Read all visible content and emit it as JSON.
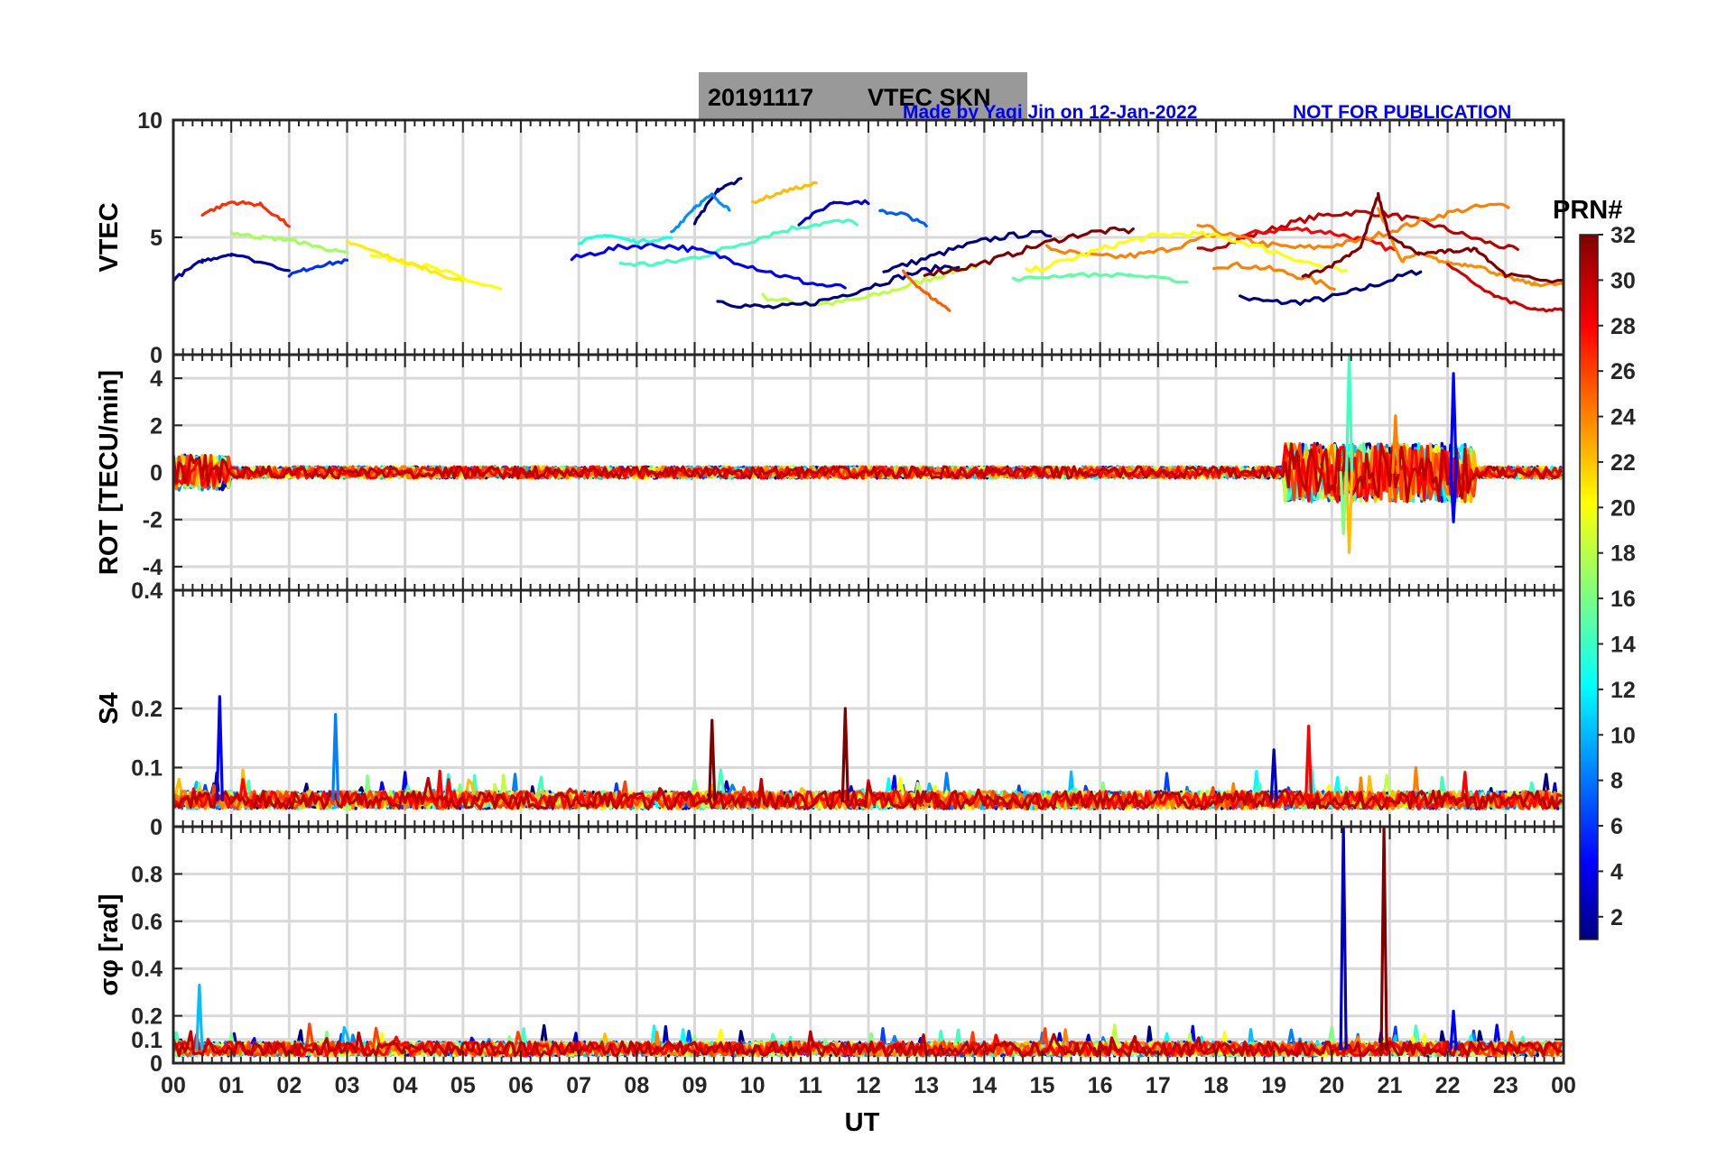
{
  "title": {
    "date": "20191117",
    "label": "VTEC  SKN"
  },
  "credit": {
    "author": "Made by Yaqi Jin on 12-Jan-2022",
    "notice": "NOT FOR PUBLICATION"
  },
  "colorbar": {
    "label": "PRN#",
    "ticks": [
      "2",
      "4",
      "6",
      "8",
      "10",
      "12",
      "14",
      "16",
      "18",
      "20",
      "22",
      "24",
      "26",
      "28",
      "30",
      "32"
    ],
    "range": [
      1,
      32
    ],
    "colormap": "jet"
  },
  "x_axis": {
    "label": "UT",
    "ticks": [
      "00",
      "01",
      "02",
      "03",
      "04",
      "05",
      "06",
      "07",
      "08",
      "09",
      "10",
      "11",
      "12",
      "13",
      "14",
      "15",
      "16",
      "17",
      "18",
      "19",
      "20",
      "21",
      "22",
      "23",
      "00"
    ],
    "range_hours": [
      0,
      24
    ]
  },
  "chart_data": [
    {
      "type": "line",
      "ylabel": "VTEC",
      "ylim": [
        0,
        10
      ],
      "yticks": [
        "0",
        "5",
        "10"
      ],
      "grid": true,
      "series": [
        {
          "prn": 2,
          "color": "#00007f",
          "x": [
            9.0,
            9.4,
            9.8
          ],
          "y": [
            5.6,
            7.0,
            7.5
          ]
        },
        {
          "prn": 3,
          "color": "#0000a8",
          "x": [
            0,
            0.5,
            1,
            2
          ],
          "y": [
            3.2,
            4.0,
            4.3,
            3.6
          ]
        },
        {
          "prn": 5,
          "color": "#0000d4",
          "x": [
            10.8,
            11.4,
            12.0
          ],
          "y": [
            5.6,
            6.5,
            6.5
          ]
        },
        {
          "prn": 6,
          "color": "#0030ff",
          "x": [
            2.0,
            2.5,
            3.0
          ],
          "y": [
            3.4,
            3.8,
            4.0
          ]
        },
        {
          "prn": 8,
          "color": "#005cff",
          "x": [
            12.2,
            12.6,
            13.0
          ],
          "y": [
            6.1,
            6.0,
            5.5
          ]
        },
        {
          "prn": 10,
          "color": "#0090ff",
          "x": [
            8.6,
            9.0,
            9.3,
            9.6
          ],
          "y": [
            5.2,
            6.3,
            6.8,
            6.2
          ]
        },
        {
          "prn": 13,
          "color": "#20ffdd",
          "x": [
            7.0,
            7.5,
            8.0,
            8.6
          ],
          "y": [
            4.8,
            5.1,
            4.8,
            5.0
          ]
        },
        {
          "prn": 15,
          "color": "#5cffa1",
          "x": [
            14.5,
            15.5,
            16.5,
            17.5
          ],
          "y": [
            3.2,
            3.4,
            3.4,
            3.1
          ]
        },
        {
          "prn": 18,
          "color": "#a1ff5c",
          "x": [
            1,
            1.5,
            2,
            2.5,
            3.0
          ],
          "y": [
            5.2,
            5.0,
            4.9,
            4.6,
            4.3
          ]
        },
        {
          "prn": 20,
          "color": "#ffec00",
          "x": [
            3.0,
            3.7,
            4.3,
            5.0
          ],
          "y": [
            4.8,
            4.2,
            3.7,
            3.1
          ]
        },
        {
          "prn": 22,
          "color": "#ffbc00",
          "x": [
            10.0,
            10.6,
            11.1
          ],
          "y": [
            6.5,
            7.0,
            7.3
          ]
        },
        {
          "prn": 24,
          "color": "#ff8c00",
          "x": [
            20.8,
            21.2,
            21.5,
            22.0,
            22.5,
            23.0,
            23.5,
            24.0
          ],
          "y": [
            6.2,
            4.0,
            4.3,
            3.9,
            3.8,
            3.3,
            3.0,
            3.0
          ]
        },
        {
          "prn": 26,
          "color": "#ff5d00",
          "x": [
            12.6,
            13.0,
            13.4
          ],
          "y": [
            3.5,
            2.6,
            1.9
          ]
        },
        {
          "prn": 28,
          "color": "#ff2d00",
          "x": [
            0.5,
            1.0,
            1.5,
            2.0
          ],
          "y": [
            6.0,
            6.5,
            6.4,
            5.5
          ]
        },
        {
          "prn": 30,
          "color": "#d40000",
          "x": [
            22.0,
            22.8,
            23.5,
            24.0
          ],
          "y": [
            3.8,
            2.5,
            1.9,
            1.9
          ]
        },
        {
          "prn": 32,
          "color": "#800000",
          "x": [
            19.5,
            20.0,
            20.5,
            20.8,
            21.0,
            21.5,
            22.0,
            22.5,
            23.0,
            24.0
          ],
          "y": [
            3.3,
            3.8,
            4.6,
            6.8,
            5.0,
            4.3,
            4.4,
            4.5,
            3.4,
            3.1
          ]
        }
      ]
    },
    {
      "type": "line",
      "ylabel": "ROT [TECU/min]",
      "ylim": [
        -5,
        5
      ],
      "yticks": [
        "4",
        "2",
        "0",
        "-2",
        "-4"
      ],
      "grid": true,
      "peaks": [
        {
          "prn": 14,
          "x": 20.3,
          "y": 5.0
        },
        {
          "prn": 22,
          "x": 20.3,
          "y": -3.4
        },
        {
          "prn": 4,
          "x": 22.1,
          "y": 4.2
        },
        {
          "prn": 4,
          "x": 22.1,
          "y": -2.1
        },
        {
          "prn": 24,
          "x": 21.1,
          "y": 2.4
        },
        {
          "prn": 16,
          "x": 20.2,
          "y": -2.6
        }
      ]
    },
    {
      "type": "line",
      "ylabel": "S4",
      "ylim": [
        0,
        0.4
      ],
      "yticks": [
        "0",
        "0.1",
        "0.2",
        "0.4"
      ],
      "grid": true,
      "peaks": [
        {
          "prn": 4,
          "x": 0.8,
          "y": 0.22
        },
        {
          "prn": 8,
          "x": 2.8,
          "y": 0.19
        },
        {
          "prn": 32,
          "x": 9.3,
          "y": 0.18
        },
        {
          "prn": 32,
          "x": 11.6,
          "y": 0.2
        },
        {
          "prn": 29,
          "x": 19.6,
          "y": 0.17
        },
        {
          "prn": 2,
          "x": 19.0,
          "y": 0.13
        }
      ]
    },
    {
      "type": "line",
      "ylabel": "σφ [rad]",
      "ylim": [
        0,
        1
      ],
      "yticks": [
        "0",
        "0.1",
        "0.2",
        "0.4",
        "0.6",
        "0.8"
      ],
      "grid": true,
      "peaks": [
        {
          "prn": 2,
          "x": 20.2,
          "y": 1.0
        },
        {
          "prn": 32,
          "x": 20.9,
          "y": 1.0
        },
        {
          "prn": 11,
          "x": 0.45,
          "y": 0.33
        },
        {
          "prn": 5,
          "x": 22.1,
          "y": 0.22
        }
      ]
    }
  ]
}
